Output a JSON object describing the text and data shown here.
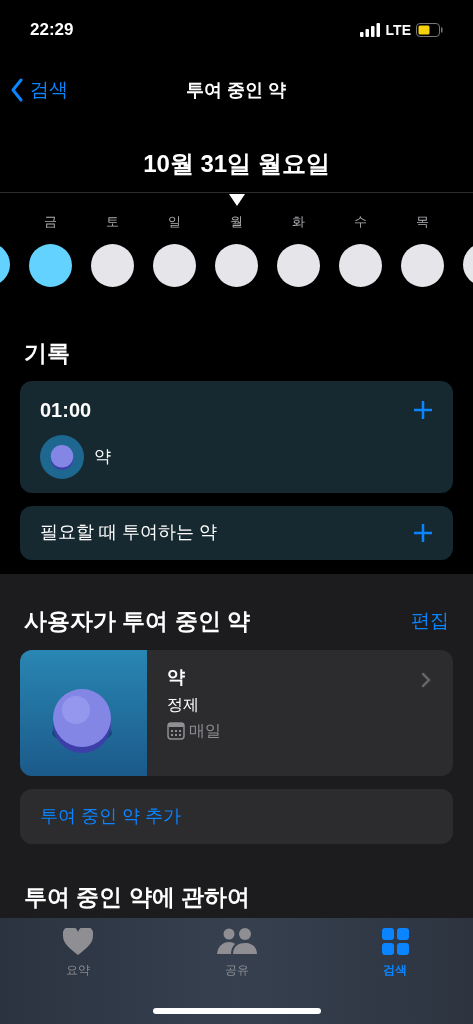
{
  "status_bar": {
    "time": "22:29",
    "network": "LTE"
  },
  "nav": {
    "back": "검색",
    "title": "투여 중인 약"
  },
  "date_title": "10월 31일 월요일",
  "days": [
    {
      "filled": true
    },
    {
      "label": "금",
      "filled": true
    },
    {
      "label": "토",
      "filled": false
    },
    {
      "label": "일",
      "filled": false
    },
    {
      "label": "월",
      "filled": false
    },
    {
      "label": "화",
      "filled": false
    },
    {
      "label": "수",
      "filled": false
    },
    {
      "label": "목",
      "filled": false
    },
    {
      "filled": false
    }
  ],
  "log": {
    "heading": "기록",
    "time": "01:00",
    "medication": "약",
    "as_needed": "필요할 때 투여하는 약"
  },
  "your_meds": {
    "heading": "사용자가 투여 중인 약",
    "edit": "편집",
    "items": [
      {
        "name": "약",
        "form": "정제",
        "schedule": "매일"
      }
    ],
    "add": "투여 중인 약 추가"
  },
  "about": {
    "heading": "투여 중인 약에 관하여"
  },
  "tabs": [
    {
      "kind": "heart",
      "label": "요약",
      "selected": false
    },
    {
      "kind": "people",
      "label": "공유",
      "selected": false
    },
    {
      "kind": "grid",
      "label": "검색",
      "selected": true
    }
  ]
}
